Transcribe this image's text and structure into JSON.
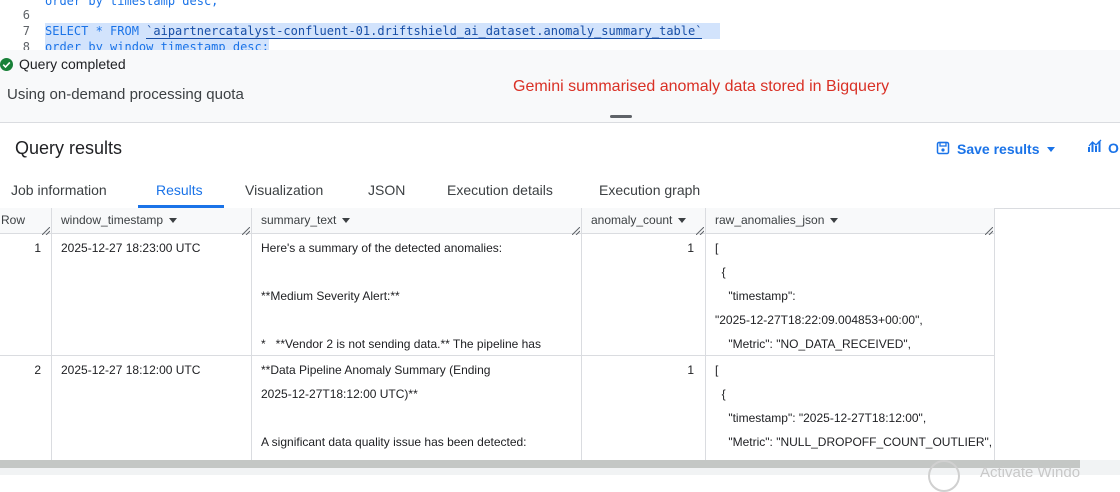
{
  "editor": {
    "lines": [
      {
        "num": "",
        "text": "order by timestamp desc;"
      },
      {
        "num": "6",
        "text": ""
      },
      {
        "num": "7",
        "text_pre": "SELECT * FROM ",
        "text_table": "`aipartnercatalyst-confluent-01.driftshield_ai_dataset.anomaly_summary_table`"
      },
      {
        "num": "8",
        "text": "order by window_timestamp desc;"
      }
    ]
  },
  "status": {
    "query_completed": "Query completed",
    "quota": "Using on-demand processing quota",
    "annotation": "Gemini summarised anomaly data stored in Bigquery"
  },
  "results": {
    "title": "Query results",
    "save_label": "Save results",
    "open_label": "O"
  },
  "tabs": [
    "Job information",
    "Results",
    "Visualization",
    "JSON",
    "Execution details",
    "Execution graph"
  ],
  "table": {
    "columns": [
      "Row",
      "window_timestamp",
      "summary_text",
      "anomaly_count",
      "raw_anomalies_json"
    ],
    "rows": [
      {
        "row": "1",
        "window_timestamp": "2025-12-27 18:23:00 UTC",
        "summary": [
          "Here's a summary of the detected anomalies:",
          "",
          "**Medium Severity Alert:**",
          "",
          "*   **Vendor 2 is not sending data.** The pipeline has"
        ],
        "anomaly_count": "1",
        "raw": [
          "[",
          "  {",
          "    \"timestamp\":",
          "\"2025-12-27T18:22:09.004853+00:00\",",
          "    \"Metric\": \"NO_DATA_RECEIVED\","
        ]
      },
      {
        "row": "2",
        "window_timestamp": "2025-12-27 18:12:00 UTC",
        "summary": [
          "**Data Pipeline Anomaly Summary (Ending",
          "2025-12-27T18:12:00 UTC)**",
          "",
          "A significant data quality issue has been detected:"
        ],
        "anomaly_count": "1",
        "raw": [
          "[",
          "  {",
          "    \"timestamp\": \"2025-12-27T18:12:00\",",
          "    \"Metric\": \"NULL_DROPOFF_COUNT_OUTLIER\","
        ]
      }
    ]
  },
  "watermark": "Activate Windo",
  "colors": {
    "accent": "#1a73e8",
    "annotation": "#d93025",
    "success": "#188038"
  }
}
